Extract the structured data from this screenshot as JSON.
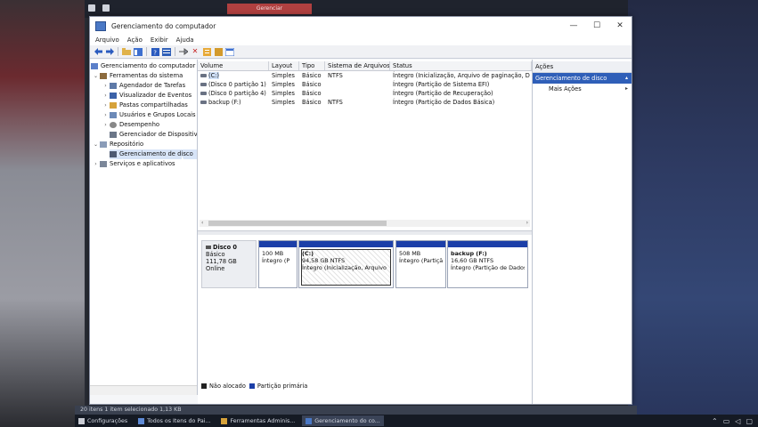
{
  "background": {
    "top_tab": "Gerenciar"
  },
  "window": {
    "title": "Gerenciamento do computador",
    "controls": {
      "minimize": "—",
      "maximize": "☐",
      "close": "✕"
    }
  },
  "menu": [
    "Arquivo",
    "Ação",
    "Exibir",
    "Ajuda"
  ],
  "toolbar": {
    "icons": [
      "back-arrow-icon",
      "forward-arrow-icon",
      "folder-up-icon",
      "console-tree-icon",
      "help-icon",
      "disk-list-icon",
      "connect-icon",
      "delete-icon",
      "properties-icon",
      "new-folder-icon",
      "export-icon"
    ]
  },
  "tree": {
    "root": "Gerenciamento do computador",
    "system_tools": "Ferramentas do sistema",
    "task_scheduler": "Agendador de Tarefas",
    "event_viewer": "Visualizador de Eventos",
    "shared_folders": "Pastas compartilhadas",
    "users_groups": "Usuários e Grupos Locais",
    "performance": "Desempenho",
    "device_manager": "Gerenciador de Dispositivos",
    "storage": "Repositório",
    "disk_management": "Gerenciamento de disco",
    "services": "Serviços e aplicativos"
  },
  "volumes": {
    "columns": [
      "Volume",
      "Layout",
      "Tipo",
      "Sistema de Arquivos",
      "Status"
    ],
    "rows": [
      {
        "volume": "(C:)",
        "layout": "Simples",
        "tipo": "Básico",
        "fs": "NTFS",
        "status": "Íntegro (Inicialização, Arquivo de paginação, D"
      },
      {
        "volume": "(Disco 0 partição 1)",
        "layout": "Simples",
        "tipo": "Básico",
        "fs": "",
        "status": "Íntegro (Partição de Sistema EFI)"
      },
      {
        "volume": "(Disco 0 partição 4)",
        "layout": "Simples",
        "tipo": "Básico",
        "fs": "",
        "status": "Íntegro (Partição de Recuperação)"
      },
      {
        "volume": "backup (F:)",
        "layout": "Simples",
        "tipo": "Básico",
        "fs": "NTFS",
        "status": "Íntegro (Partição de Dados Básica)"
      }
    ]
  },
  "disk0": {
    "name": "Disco 0",
    "type": "Básico",
    "size": "111,78 GB",
    "state": "Online",
    "partitions": [
      {
        "title": "",
        "size": "100 MB",
        "status": "Íntegro (P"
      },
      {
        "title": "(C:)",
        "size": "94,58 GB NTFS",
        "status": "Íntegro (Inicialização, Arquivo"
      },
      {
        "title": "",
        "size": "508 MB",
        "status": "Íntegro (Partiçã"
      },
      {
        "title": "backup (F:)",
        "size": "16,60 GB NTFS",
        "status": "Íntegro (Partição de Dados"
      }
    ]
  },
  "legend": {
    "unallocated": "Não alocado",
    "primary": "Partição primária"
  },
  "actions": {
    "header": "Ações",
    "context": "Gerenciamento de disco",
    "more": "Mais Ações"
  },
  "status_bar": "20 itens  1 item selecionado  1,13 KB",
  "taskbar": {
    "items": [
      "Configurações",
      "Todos os Itens do Pai...",
      "Ferramentas Adminis...",
      "Gerenciamento do co..."
    ]
  },
  "colors": {
    "primary_partition": "#1c3fa8",
    "selection": "#2f5fb8",
    "unallocated": "#222222"
  }
}
